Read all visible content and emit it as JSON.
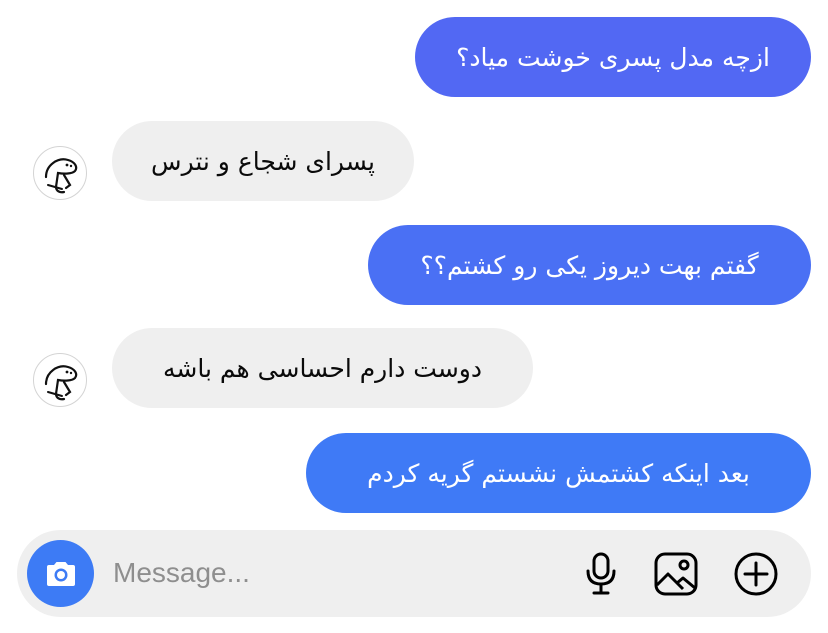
{
  "colors": {
    "outgoing_bubble_top": "#5466f2",
    "outgoing_bubble_bottom": "#3f7bf6",
    "incoming_bubble": "#efefef",
    "camera_button": "#3d7bf5",
    "composer_background": "#efefef"
  },
  "conversation": {
    "messages": [
      {
        "direction": "outgoing",
        "text": "ازچه مدل پسری خوشت میاد؟"
      },
      {
        "direction": "incoming",
        "text": "پسرای شجاع و نترس",
        "avatar_icon": "cartoon-face-avatar-icon"
      },
      {
        "direction": "outgoing",
        "text": "گفتم بهت دیروز یکی رو کشتم؟؟"
      },
      {
        "direction": "incoming",
        "text": "دوست دارم احساسی هم باشه",
        "avatar_icon": "cartoon-face-avatar-icon"
      },
      {
        "direction": "outgoing",
        "text": "بعد اینکه کشتمش نشستم گریه کردم"
      }
    ]
  },
  "composer": {
    "placeholder": "Message...",
    "value": "",
    "icons": [
      "camera-icon",
      "microphone-icon",
      "image-icon",
      "add-icon"
    ]
  }
}
